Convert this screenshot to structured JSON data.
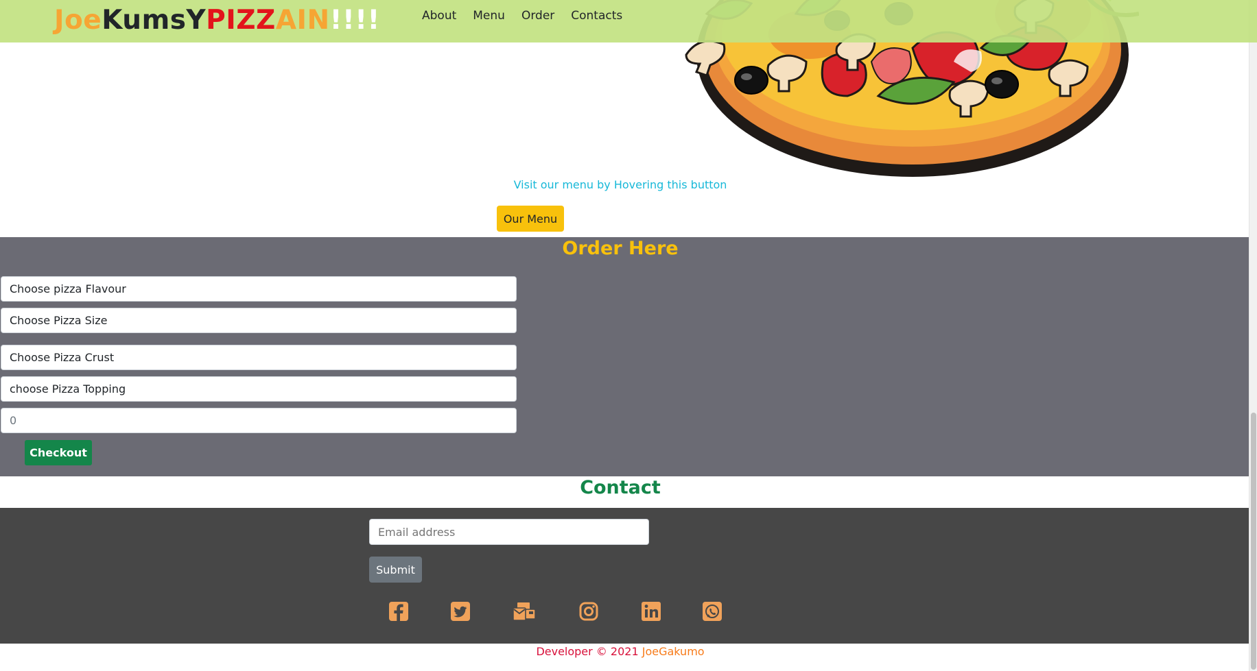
{
  "navbar": {
    "brand_parts": [
      "Joe",
      "Kums",
      "Y",
      "PIZZ",
      "AIN",
      "!!!!"
    ],
    "brand_colors": [
      "#f6a534",
      "#212529",
      "#212529",
      "#e3141b",
      "#f6a534",
      "#ffffff"
    ],
    "links": [
      "About",
      "Menu",
      "Order",
      "Contacts"
    ]
  },
  "hero": {
    "visit_text": "Visit our menu by Hovering this button",
    "menu_button": "Our Menu"
  },
  "order": {
    "title": "Order Here",
    "fields": [
      "Choose pizza Flavour",
      "Choose Pizza Size",
      "Choose Pizza Crust",
      "choose Pizza Topping"
    ],
    "quantity": "0",
    "checkout": "Checkout"
  },
  "contact": {
    "title": "Contact",
    "email_placeholder": "Email address",
    "submit": "Submit",
    "social_icons": [
      "facebook-icon",
      "twitter-icon",
      "mail-bulk-icon",
      "instagram-icon",
      "linkedin-icon",
      "whatsapp-icon"
    ],
    "icon_color": "#f0a25a"
  },
  "footer": {
    "developer": "Developer © 2021",
    "name": "JoeGakumo"
  },
  "colors": {
    "navbar_bg": "#c3e282",
    "order_bg": "#6b6b74",
    "footer_bg": "#474747",
    "accent_yellow": "#f8c10c",
    "accent_green": "#14864a",
    "link_cyan": "#17b8d8"
  }
}
